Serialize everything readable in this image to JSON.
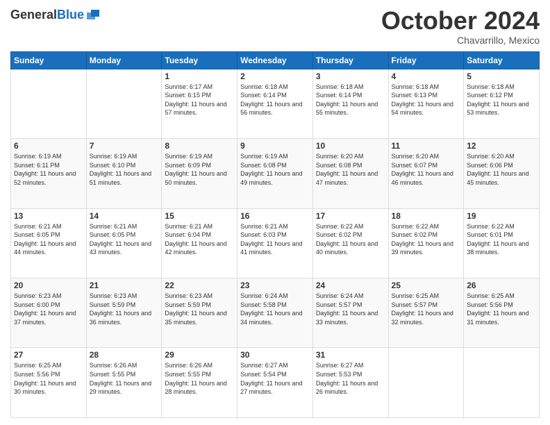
{
  "header": {
    "logo": {
      "general": "General",
      "blue": "Blue"
    },
    "month": "October 2024",
    "location": "Chavarrillo, Mexico"
  },
  "days_of_week": [
    "Sunday",
    "Monday",
    "Tuesday",
    "Wednesday",
    "Thursday",
    "Friday",
    "Saturday"
  ],
  "weeks": [
    [
      {
        "day": "",
        "data": ""
      },
      {
        "day": "",
        "data": ""
      },
      {
        "day": "1",
        "data": "Sunrise: 6:17 AM\nSunset: 6:15 PM\nDaylight: 11 hours and 57 minutes."
      },
      {
        "day": "2",
        "data": "Sunrise: 6:18 AM\nSunset: 6:14 PM\nDaylight: 11 hours and 56 minutes."
      },
      {
        "day": "3",
        "data": "Sunrise: 6:18 AM\nSunset: 6:14 PM\nDaylight: 11 hours and 55 minutes."
      },
      {
        "day": "4",
        "data": "Sunrise: 6:18 AM\nSunset: 6:13 PM\nDaylight: 11 hours and 54 minutes."
      },
      {
        "day": "5",
        "data": "Sunrise: 6:18 AM\nSunset: 6:12 PM\nDaylight: 11 hours and 53 minutes."
      }
    ],
    [
      {
        "day": "6",
        "data": "Sunrise: 6:19 AM\nSunset: 6:11 PM\nDaylight: 11 hours and 52 minutes."
      },
      {
        "day": "7",
        "data": "Sunrise: 6:19 AM\nSunset: 6:10 PM\nDaylight: 11 hours and 51 minutes."
      },
      {
        "day": "8",
        "data": "Sunrise: 6:19 AM\nSunset: 6:09 PM\nDaylight: 11 hours and 50 minutes."
      },
      {
        "day": "9",
        "data": "Sunrise: 6:19 AM\nSunset: 6:08 PM\nDaylight: 11 hours and 49 minutes."
      },
      {
        "day": "10",
        "data": "Sunrise: 6:20 AM\nSunset: 6:08 PM\nDaylight: 11 hours and 47 minutes."
      },
      {
        "day": "11",
        "data": "Sunrise: 6:20 AM\nSunset: 6:07 PM\nDaylight: 11 hours and 46 minutes."
      },
      {
        "day": "12",
        "data": "Sunrise: 6:20 AM\nSunset: 6:06 PM\nDaylight: 11 hours and 45 minutes."
      }
    ],
    [
      {
        "day": "13",
        "data": "Sunrise: 6:21 AM\nSunset: 6:05 PM\nDaylight: 11 hours and 44 minutes."
      },
      {
        "day": "14",
        "data": "Sunrise: 6:21 AM\nSunset: 6:05 PM\nDaylight: 11 hours and 43 minutes."
      },
      {
        "day": "15",
        "data": "Sunrise: 6:21 AM\nSunset: 6:04 PM\nDaylight: 11 hours and 42 minutes."
      },
      {
        "day": "16",
        "data": "Sunrise: 6:21 AM\nSunset: 6:03 PM\nDaylight: 11 hours and 41 minutes."
      },
      {
        "day": "17",
        "data": "Sunrise: 6:22 AM\nSunset: 6:02 PM\nDaylight: 11 hours and 40 minutes."
      },
      {
        "day": "18",
        "data": "Sunrise: 6:22 AM\nSunset: 6:02 PM\nDaylight: 11 hours and 39 minutes."
      },
      {
        "day": "19",
        "data": "Sunrise: 6:22 AM\nSunset: 6:01 PM\nDaylight: 11 hours and 38 minutes."
      }
    ],
    [
      {
        "day": "20",
        "data": "Sunrise: 6:23 AM\nSunset: 6:00 PM\nDaylight: 11 hours and 37 minutes."
      },
      {
        "day": "21",
        "data": "Sunrise: 6:23 AM\nSunset: 5:59 PM\nDaylight: 11 hours and 36 minutes."
      },
      {
        "day": "22",
        "data": "Sunrise: 6:23 AM\nSunset: 5:59 PM\nDaylight: 11 hours and 35 minutes."
      },
      {
        "day": "23",
        "data": "Sunrise: 6:24 AM\nSunset: 5:58 PM\nDaylight: 11 hours and 34 minutes."
      },
      {
        "day": "24",
        "data": "Sunrise: 6:24 AM\nSunset: 5:57 PM\nDaylight: 11 hours and 33 minutes."
      },
      {
        "day": "25",
        "data": "Sunrise: 6:25 AM\nSunset: 5:57 PM\nDaylight: 11 hours and 32 minutes."
      },
      {
        "day": "26",
        "data": "Sunrise: 6:25 AM\nSunset: 5:56 PM\nDaylight: 11 hours and 31 minutes."
      }
    ],
    [
      {
        "day": "27",
        "data": "Sunrise: 6:25 AM\nSunset: 5:56 PM\nDaylight: 11 hours and 30 minutes."
      },
      {
        "day": "28",
        "data": "Sunrise: 6:26 AM\nSunset: 5:55 PM\nDaylight: 11 hours and 29 minutes."
      },
      {
        "day": "29",
        "data": "Sunrise: 6:26 AM\nSunset: 5:55 PM\nDaylight: 11 hours and 28 minutes."
      },
      {
        "day": "30",
        "data": "Sunrise: 6:27 AM\nSunset: 5:54 PM\nDaylight: 11 hours and 27 minutes."
      },
      {
        "day": "31",
        "data": "Sunrise: 6:27 AM\nSunset: 5:53 PM\nDaylight: 11 hours and 26 minutes."
      },
      {
        "day": "",
        "data": ""
      },
      {
        "day": "",
        "data": ""
      }
    ]
  ]
}
